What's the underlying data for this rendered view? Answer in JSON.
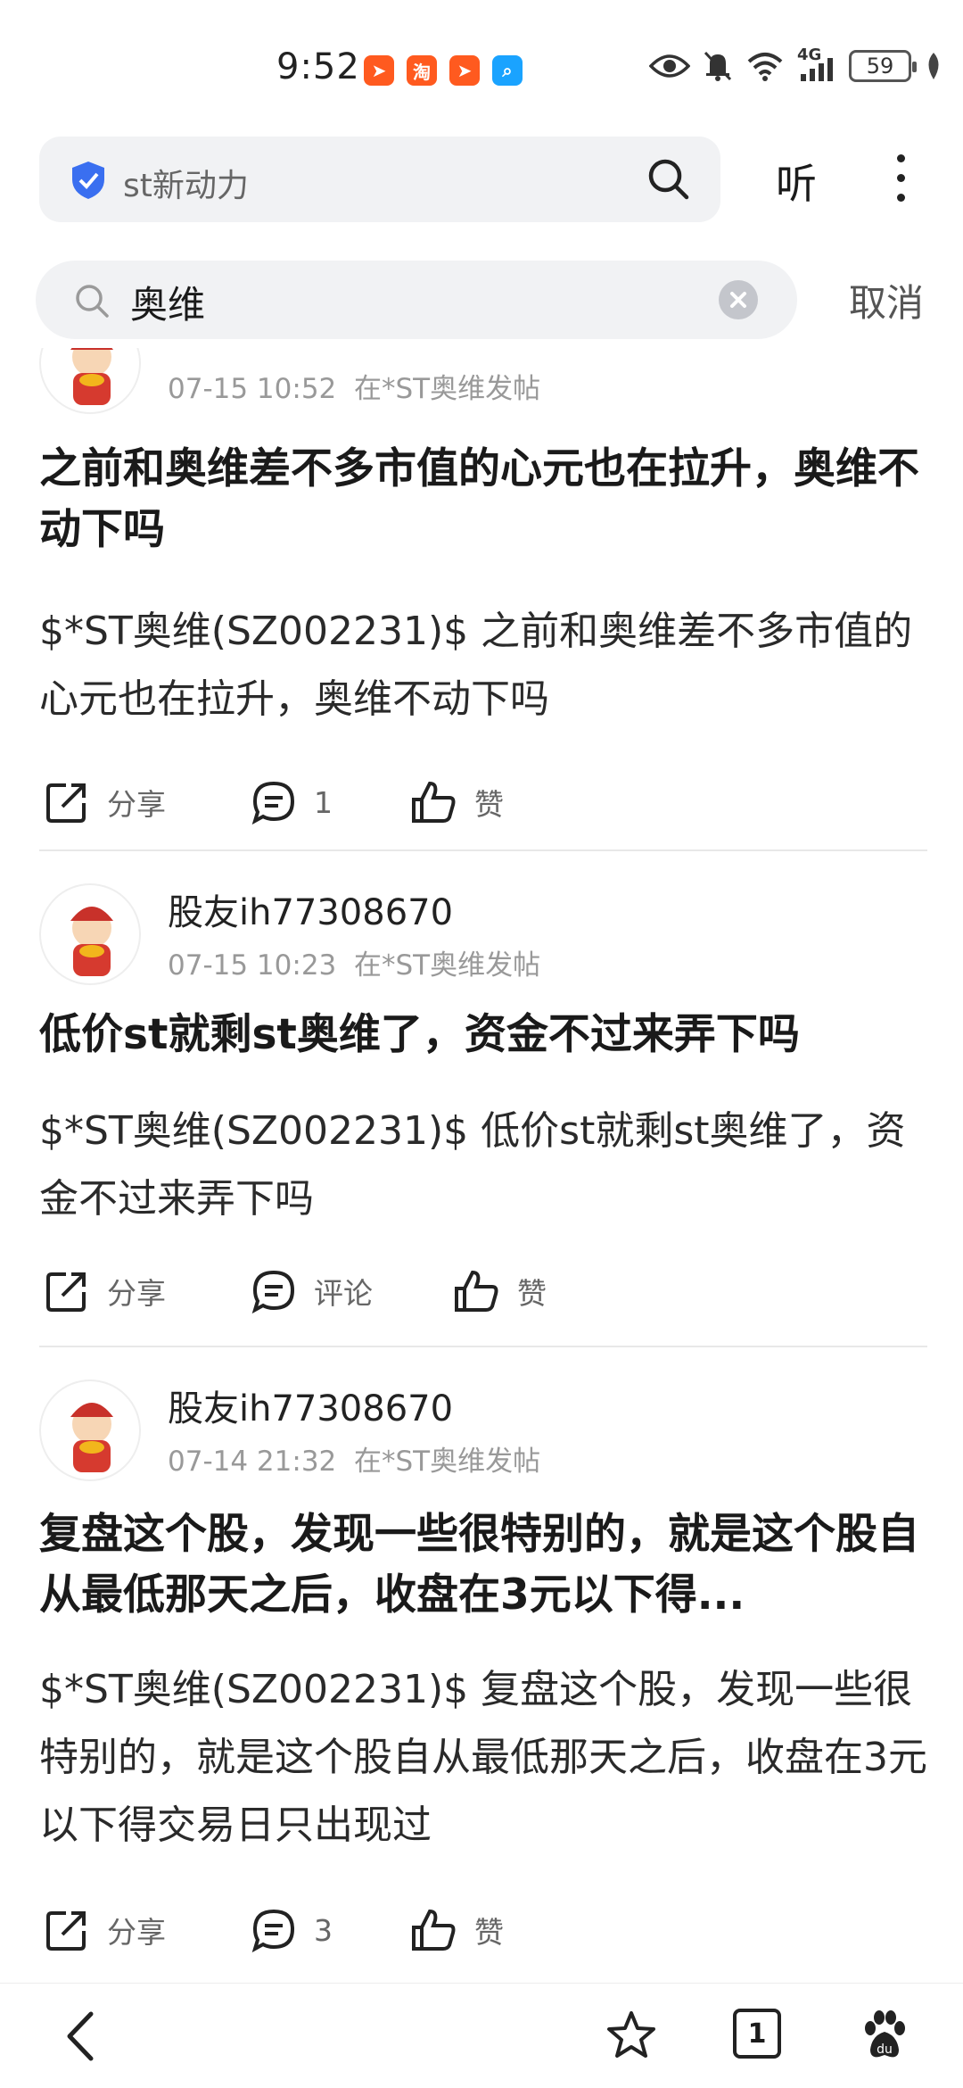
{
  "status_bar": {
    "time": "9:52",
    "battery": "59",
    "network": "4G",
    "app_icon_taobao": "淘"
  },
  "browser": {
    "site_query": "st新动力",
    "listen_label": "听"
  },
  "find": {
    "query": "奥维",
    "cancel_label": "取消"
  },
  "posts": [
    {
      "author": "",
      "time": "07-15 10:52",
      "where": "在*ST奥维发帖",
      "title": "之前和奥维差不多市值的心元也在拉升，奥维不动下吗",
      "body": "$*ST奥维(SZ002231)$ 之前和奥维差不多市值的心元也在拉升，奥维不动下吗",
      "share": "分享",
      "comment": "1",
      "like": "赞"
    },
    {
      "author": "股友ih77308670",
      "time": "07-15 10:23",
      "where": "在*ST奥维发帖",
      "title": "低价st就剩st奥维了，资金不过来弄下吗",
      "body": "$*ST奥维(SZ002231)$ 低价st就剩st奥维了，资金不过来弄下吗",
      "share": "分享",
      "comment": "评论",
      "like": "赞"
    },
    {
      "author": "股友ih77308670",
      "time": "07-14 21:32",
      "where": "在*ST奥维发帖",
      "title": "复盘这个股，发现一些很特别的，就是这个股自从最低那天之后，收盘在3元以下得...",
      "body": "$*ST奥维(SZ002231)$ 复盘这个股，发现一些很特别的，就是这个股自从最低那天之后，收盘在3元以下得交易日只出现过",
      "share": "分享",
      "comment": "3",
      "like": "赞"
    }
  ],
  "bottom_nav": {
    "tab_count": "1"
  },
  "colors": {
    "shield": "#3a6ff0",
    "app_orange": "#ff5a1f",
    "search_blue": "#1aa3ff"
  }
}
